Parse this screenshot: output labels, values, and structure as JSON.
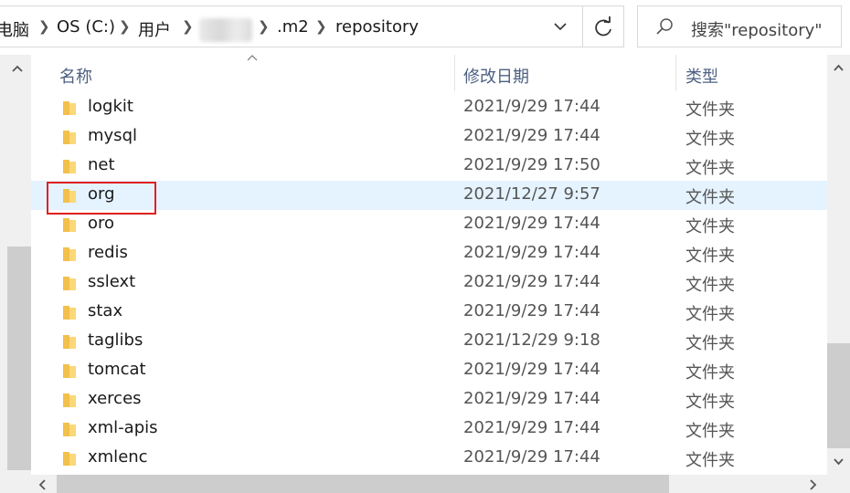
{
  "address_bar": {
    "crumbs": [
      "电脑",
      "OS (C:)",
      "用户",
      ".m2",
      "repository"
    ]
  },
  "search": {
    "placeholder": "搜索\"repository\""
  },
  "columns": {
    "name": "名称",
    "date": "修改日期",
    "type": "类型"
  },
  "rows": [
    {
      "name": "logkit",
      "date": "2021/9/29 17:44",
      "type": "文件夹"
    },
    {
      "name": "mysql",
      "date": "2021/9/29 17:44",
      "type": "文件夹"
    },
    {
      "name": "net",
      "date": "2021/9/29 17:50",
      "type": "文件夹"
    },
    {
      "name": "org",
      "date": "2021/12/27 9:57",
      "type": "文件夹",
      "selected": true
    },
    {
      "name": "oro",
      "date": "2021/9/29 17:44",
      "type": "文件夹"
    },
    {
      "name": "redis",
      "date": "2021/9/29 17:44",
      "type": "文件夹"
    },
    {
      "name": "sslext",
      "date": "2021/9/29 17:44",
      "type": "文件夹"
    },
    {
      "name": "stax",
      "date": "2021/9/29 17:44",
      "type": "文件夹"
    },
    {
      "name": "taglibs",
      "date": "2021/12/29 9:18",
      "type": "文件夹"
    },
    {
      "name": "tomcat",
      "date": "2021/9/29 17:44",
      "type": "文件夹"
    },
    {
      "name": "xerces",
      "date": "2021/9/29 17:44",
      "type": "文件夹"
    },
    {
      "name": "xml-apis",
      "date": "2021/9/29 17:44",
      "type": "文件夹"
    },
    {
      "name": "xmlenc",
      "date": "2021/9/29 17:44",
      "type": "文件夹"
    }
  ],
  "colors": {
    "selected_row": "#e5f3ff",
    "highlight_border": "#e02020",
    "folder": "#f3c04c",
    "header_text": "#4d6082"
  },
  "icons": [
    "chevron-right-icon",
    "chevron-down-icon",
    "refresh-icon",
    "search-icon",
    "folder-icon",
    "scroll-arrow-icon"
  ]
}
